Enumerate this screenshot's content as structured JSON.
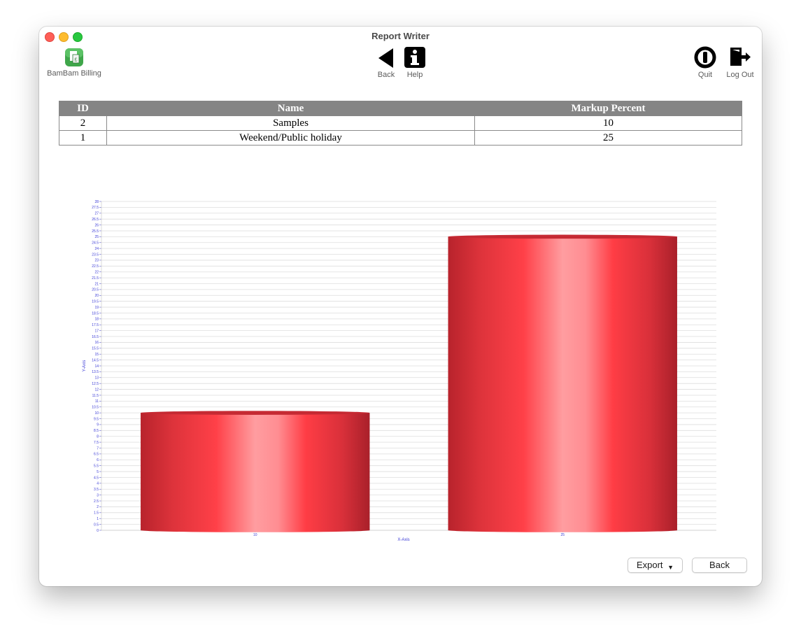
{
  "window": {
    "title": "Report Writer"
  },
  "toolbar": {
    "app_label": "BamBam Billing",
    "back_label": "Back",
    "help_label": "Help",
    "quit_label": "Quit",
    "logout_label": "Log Out"
  },
  "table": {
    "headers": [
      "ID",
      "Name",
      "Markup Percent"
    ],
    "rows": [
      [
        "2",
        "Samples",
        "10"
      ],
      [
        "1",
        "Weekend/Public holiday",
        "25"
      ]
    ]
  },
  "chart_data": {
    "type": "bar",
    "categories": [
      "10",
      "25"
    ],
    "values": [
      10,
      25
    ],
    "xlabel": "X-Axis",
    "ylabel": "Y-Axis",
    "ylim": [
      0,
      28
    ],
    "ytick_step": 0.5,
    "grid": true,
    "bar_color": "#e8333e"
  },
  "footer": {
    "export_label": "Export",
    "back_label": "Back"
  }
}
